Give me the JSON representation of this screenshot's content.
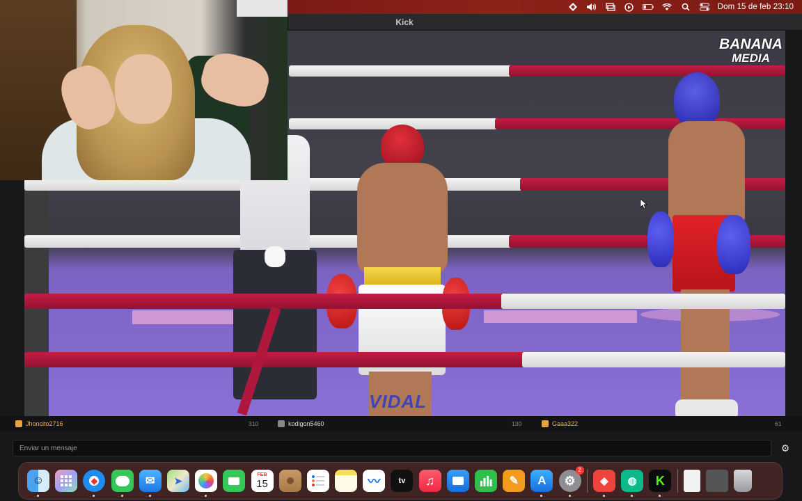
{
  "menubar": {
    "icons": [
      "location-arrow-icon",
      "volume-icon",
      "screen-mirroring-icon",
      "play-icon",
      "battery-icon",
      "wifi-icon",
      "search-icon",
      "control-center-icon"
    ],
    "clock": "Dom 15 de feb  23:10"
  },
  "window": {
    "title": "Kick"
  },
  "video": {
    "watermark_line1": "BANANA",
    "watermark_line2": "MEDIA",
    "ring_banner": "VIDAL"
  },
  "chat": {
    "messages": [
      {
        "user": "Jhoncito2716",
        "count": "310",
        "badge": "gold"
      },
      {
        "user": "kodigon5460",
        "count": "130",
        "badge": "grey"
      },
      {
        "user": "Gaaa322",
        "count": "61",
        "badge": "gold"
      }
    ],
    "input_placeholder": "Enviar un mensaje"
  },
  "dock": {
    "calendar_month": "FEB",
    "calendar_day": "15",
    "settings_badge": "2",
    "apps": [
      "Finder",
      "Launchpad",
      "Safari",
      "Messages",
      "Mail",
      "Maps",
      "Photos",
      "FaceTime",
      "Calendar",
      "Contacts",
      "Reminders",
      "Notes",
      "Freeform",
      "TV",
      "Music",
      "Keynote",
      "Numbers",
      "Pages",
      "App Store",
      "System Settings",
      "AnyDesk",
      "Messenger",
      "Kick",
      "Downloads",
      "Stack",
      "Trash"
    ]
  },
  "colors": {
    "rope_red": "#b0173c",
    "kick_green": "#53fc18",
    "wallpaper_red": "#8d2218"
  }
}
